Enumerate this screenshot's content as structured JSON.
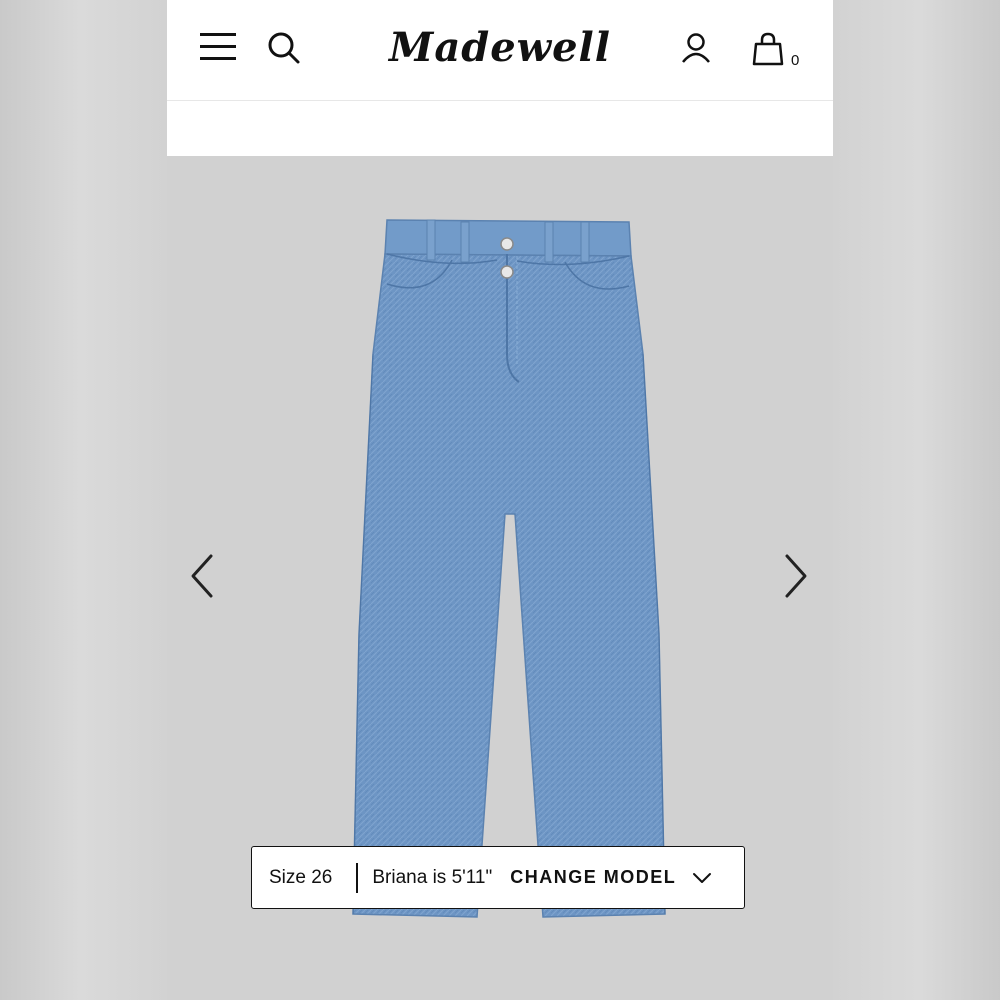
{
  "header": {
    "brand": "Madewell",
    "bag_count": "0",
    "icons": [
      "menu-icon",
      "search-icon",
      "account-icon",
      "bag-icon"
    ]
  },
  "product": {
    "image": "denim-jeans-flat-lay",
    "model_bar": {
      "size": "Size 26",
      "model_info": "Briana is 5'11\"",
      "change_label": "CHANGE MODEL"
    }
  },
  "colors": {
    "header_bg": "#ffffff",
    "stage_bg": "#d1d1d1",
    "denim": "#6d95c4",
    "text": "#111111"
  }
}
